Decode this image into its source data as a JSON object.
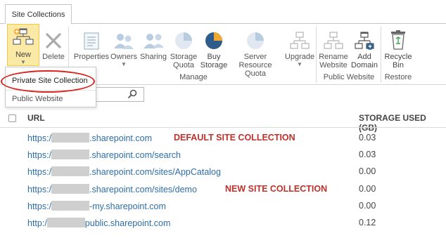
{
  "ribbon": {
    "tab_label": "Site Collections",
    "buttons": {
      "new": "New",
      "delete": "Delete",
      "properties": "Properties",
      "owners": "Owners",
      "sharing": "Sharing",
      "storage_quota": "Storage\nQuota",
      "buy_storage": "Buy\nStorage",
      "server_resource_quota": "Server Resource\nQuota",
      "upgrade": "Upgrade",
      "rename_website": "Rename\nWebsite",
      "add_domain": "Add\nDomain",
      "recycle_bin": "Recycle\nBin"
    },
    "groups": {
      "manage": "Manage",
      "public_website": "Public Website",
      "restore": "Restore"
    }
  },
  "dropdown": {
    "items": [
      "Private Site Collection",
      "Public Website"
    ]
  },
  "table": {
    "headers": {
      "url": "URL",
      "storage": "STORAGE USED (GB)"
    },
    "rows": [
      {
        "pre": "https:/",
        "post": ".sharepoint.com",
        "storage": "0.03",
        "annotation": "DEFAULT SITE COLLECTION"
      },
      {
        "pre": "https:/",
        "post": ".sharepoint.com/search",
        "storage": "0.03",
        "annotation": ""
      },
      {
        "pre": "https:/",
        "post": ".sharepoint.com/sites/AppCatalog",
        "storage": "0.00",
        "annotation": ""
      },
      {
        "pre": "https:/",
        "post": ".sharepoint.com/sites/demo",
        "storage": "0.00",
        "annotation": "NEW SITE COLLECTION"
      },
      {
        "pre": "https:/",
        "post": "-my.sharepoint.com",
        "storage": "0.00",
        "annotation": ""
      },
      {
        "pre": "http:/",
        "post": "public.sharepoint.com",
        "storage": "0.12",
        "annotation": ""
      }
    ]
  },
  "colors": {
    "link": "#2d6ea8",
    "annotation": "#c0302a",
    "highlight_ring": "#d9231f",
    "new_button_bg": "#fbe9a6"
  }
}
